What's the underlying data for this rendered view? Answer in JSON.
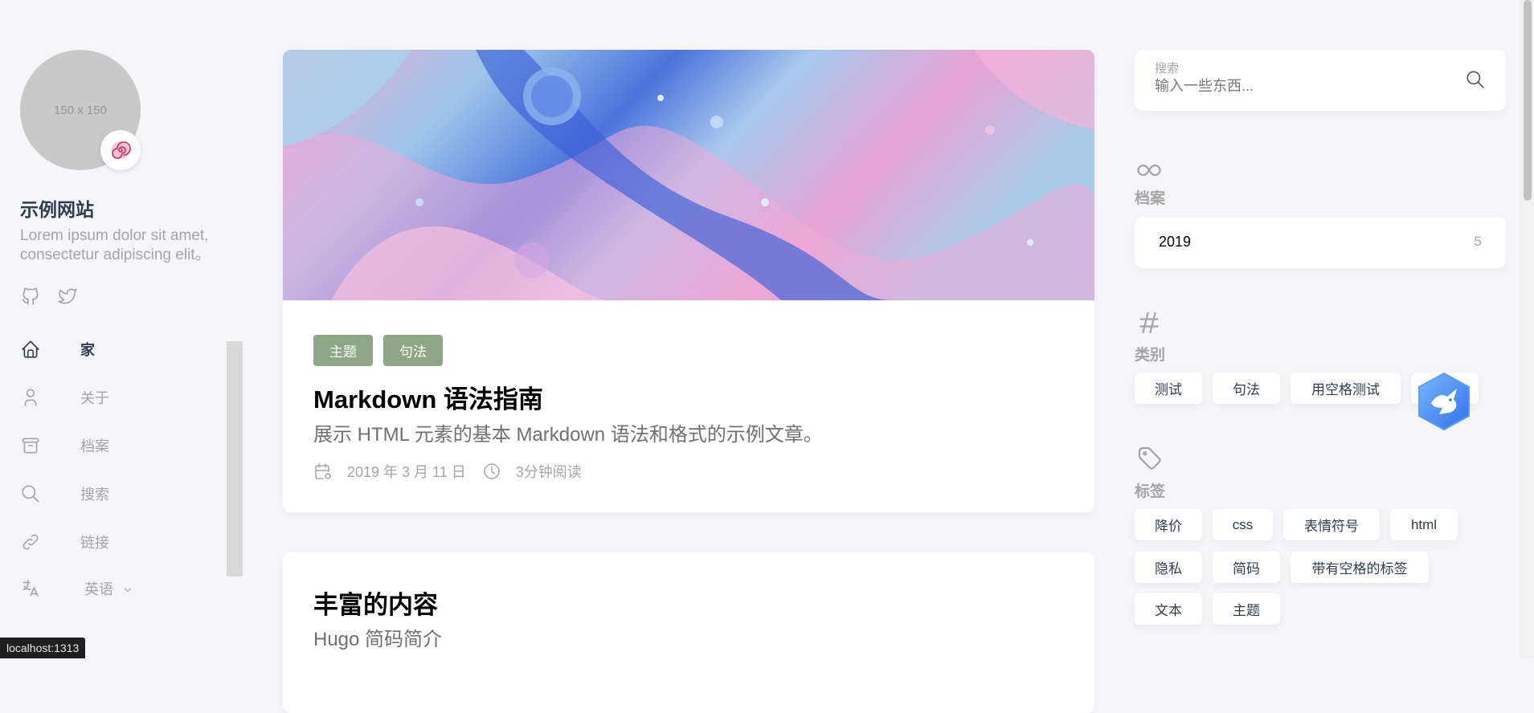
{
  "sidebar": {
    "avatar_text": "150 x 150",
    "site_title": "示例网站",
    "site_desc": "Lorem ipsum dolor sit amet, consectetur adipiscing elit。",
    "menu": [
      {
        "label": "家",
        "icon": "home-icon"
      },
      {
        "label": "关于",
        "icon": "user-icon"
      },
      {
        "label": "档案",
        "icon": "archive-icon"
      },
      {
        "label": "搜索",
        "icon": "search-icon"
      },
      {
        "label": "链接",
        "icon": "link-icon"
      },
      {
        "label": "英语",
        "icon": "language-icon"
      }
    ]
  },
  "posts": [
    {
      "tags": [
        "主题",
        "句法"
      ],
      "title": "Markdown 语法指南",
      "subtitle": "展示 HTML 元素的基本 Markdown 语法和格式的示例文章。",
      "date": "2019 年 3 月 11 日",
      "read_time": "3分钟阅读"
    },
    {
      "title": "丰富的内容",
      "subtitle": "Hugo 简码简介"
    }
  ],
  "search": {
    "label": "搜索",
    "placeholder": "输入一些东西..."
  },
  "archives": {
    "title": "档案",
    "items": [
      {
        "year": "2019",
        "count": "5"
      }
    ]
  },
  "categories": {
    "title": "类别",
    "items": [
      "测试",
      "句法",
      "用空格测试"
    ]
  },
  "tags_widget": {
    "title": "标签",
    "items": [
      "降价",
      "css",
      "表情符号",
      "html",
      "隐私",
      "简码",
      "带有空格的标签",
      "文本",
      "主题"
    ]
  },
  "status_bar": "localhost:1313",
  "colors": {
    "background": "#f5f5fa",
    "tag_accent": "#8ea885",
    "text_primary": "#2c3e50",
    "text_muted": "#a5a5a5"
  }
}
